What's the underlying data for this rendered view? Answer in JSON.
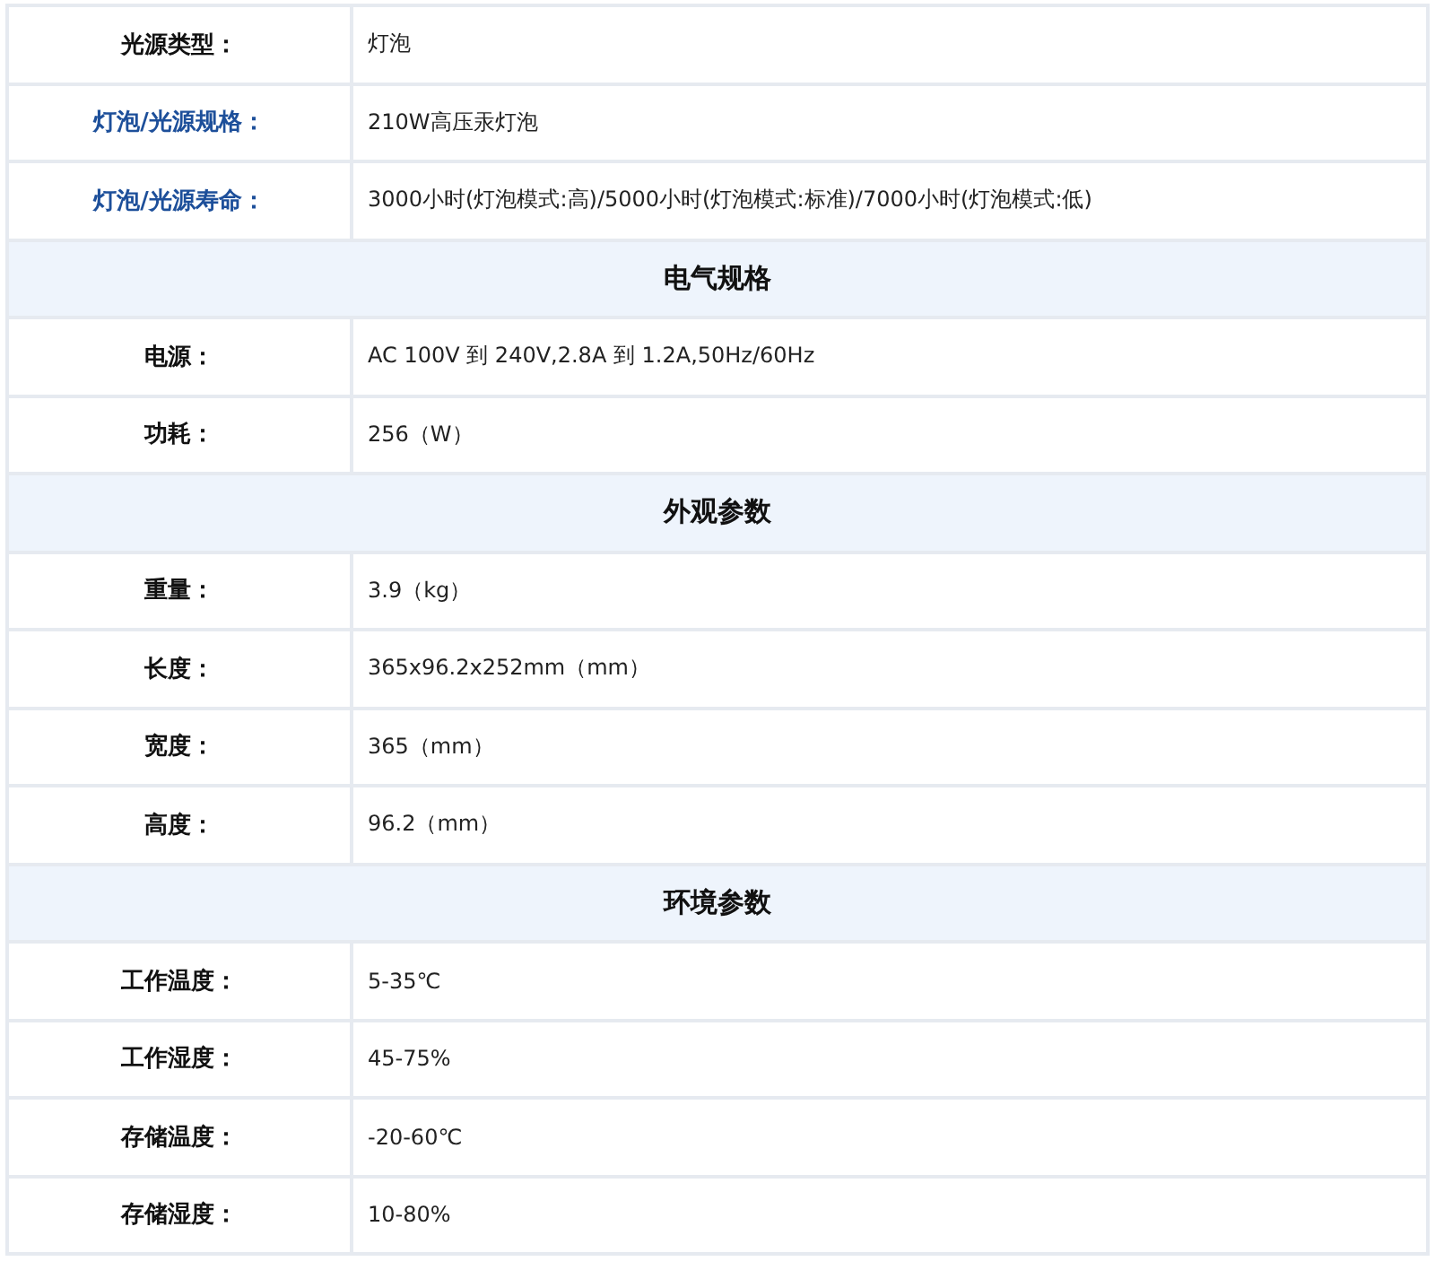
{
  "rows": [
    {
      "kind": "row",
      "label": "光源类型：",
      "value": "灯泡"
    },
    {
      "kind": "link_row",
      "label": "灯泡/光源规格：",
      "value": "210W高压汞灯泡"
    },
    {
      "kind": "link_row",
      "label": "灯泡/光源寿命：",
      "value": "3000小时(灯泡模式:高)/5000小时(灯泡模式:标准)/7000小时(灯泡模式:低)"
    },
    {
      "kind": "section",
      "title": "电气规格"
    },
    {
      "kind": "row",
      "label": "电源：",
      "value": "AC 100V 到 240V,2.8A 到 1.2A,50Hz/60Hz"
    },
    {
      "kind": "row",
      "label": "功耗：",
      "value": "256（W）"
    },
    {
      "kind": "section",
      "title": "外观参数"
    },
    {
      "kind": "row",
      "label": "重量：",
      "value": "3.9（kg）"
    },
    {
      "kind": "row",
      "label": "长度：",
      "value": "365x96.2x252mm（mm）"
    },
    {
      "kind": "row",
      "label": "宽度：",
      "value": "365（mm）"
    },
    {
      "kind": "row",
      "label": "高度：",
      "value": "96.2（mm）"
    },
    {
      "kind": "section",
      "title": "环境参数"
    },
    {
      "kind": "row",
      "label": "工作温度：",
      "value": "5-35℃"
    },
    {
      "kind": "row",
      "label": "工作湿度：",
      "value": "45-75%"
    },
    {
      "kind": "row",
      "label": "存储温度：",
      "value": "-20-60℃"
    },
    {
      "kind": "row",
      "label": "存储湿度：",
      "value": "10-80%"
    }
  ]
}
